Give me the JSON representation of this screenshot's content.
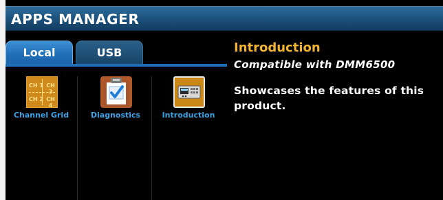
{
  "header": {
    "title": "APPS MANAGER"
  },
  "tabs": [
    {
      "label": "Local",
      "active": true
    },
    {
      "label": "USB",
      "active": false
    }
  ],
  "apps": [
    {
      "label": "Channel Grid",
      "icon": "channel-grid-icon",
      "icon_text": [
        "CH 1",
        "CH 3",
        "CH 2",
        "CH 4"
      ]
    },
    {
      "label": "Diagnostics",
      "icon": "clipboard-check-icon"
    },
    {
      "label": "Introduction",
      "icon": "instrument-icon",
      "selected": true
    }
  ],
  "detail": {
    "title": "Introduction",
    "subtitle": "Compatible with DMM6500",
    "description": "Showcases the features of this product."
  },
  "colors": {
    "title_bar": "#1d5581",
    "tab_active": "#1f6fb8",
    "tab_inactive": "#174468",
    "app_label": "#3ea3e6",
    "detail_title": "#f1b333"
  }
}
